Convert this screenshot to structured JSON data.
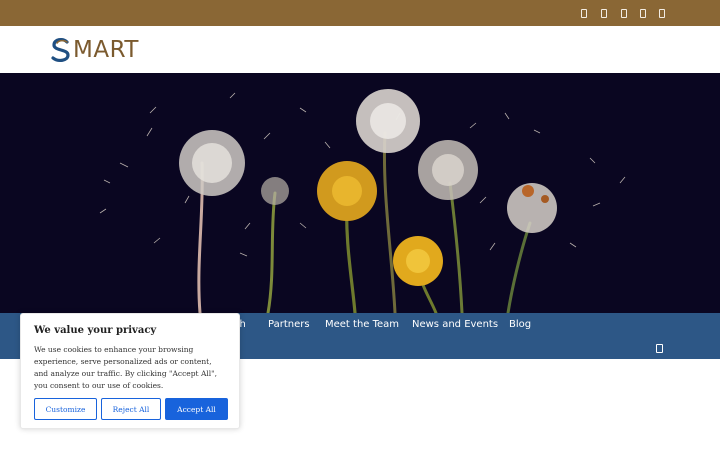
{
  "topbar": {
    "social_icons": [
      "facebook-icon",
      "twitter-icon",
      "linkedin-icon",
      "instagram-icon",
      "youtube-icon"
    ],
    "background": "#8a6735"
  },
  "header": {
    "logo_text": "MART",
    "logo_alt": "SMART"
  },
  "hero": {
    "image": "dandelions on dark background",
    "background": "#0a0621"
  },
  "nav": {
    "items": [
      {
        "label": "ch"
      },
      {
        "label": "Partners"
      },
      {
        "label": "Meet the Team"
      },
      {
        "label": "News and Events"
      },
      {
        "label": "Blog"
      }
    ],
    "search_icon": "search-icon",
    "background": "#2d5786"
  },
  "cookie_banner": {
    "title": "We value your privacy",
    "text": "We use cookies to enhance your browsing experience, serve personalized ads or content, and analyze our traffic. By clicking \"Accept All\", you consent to our use of cookies.",
    "buttons": {
      "customize": "Customize",
      "reject": "Reject All",
      "accept": "Accept All"
    },
    "accent": "#1863dc"
  }
}
